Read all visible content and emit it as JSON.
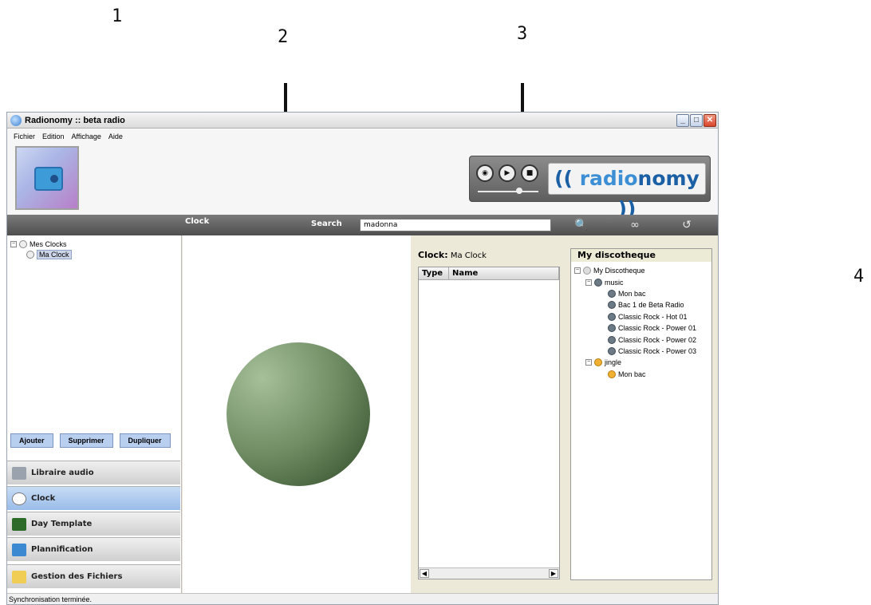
{
  "annotations": {
    "n1": "1",
    "n2": "2",
    "n3": "3",
    "n4": "4"
  },
  "window": {
    "title": "Radionomy :: beta radio"
  },
  "menu": [
    "Fichier",
    "Edition",
    "Affichage",
    "Aide"
  ],
  "brand": {
    "part1": "(( ",
    "part2": "radio",
    "part3": "nomy ))"
  },
  "toolbar": {
    "clock_label": "Clock",
    "search_label": "Search",
    "search_value": "madonna"
  },
  "clocks_tree": {
    "root": "Mes Clocks",
    "child": "Ma Clock"
  },
  "clock_buttons": {
    "add": "Ajouter",
    "delete": "Supprimer",
    "duplicate": "Dupliquer"
  },
  "nav": [
    {
      "label": "Libraire audio"
    },
    {
      "label": "Clock"
    },
    {
      "label": "Day Template"
    },
    {
      "label": "Plannification"
    },
    {
      "label": "Gestion des Fichiers"
    }
  ],
  "clock_panel": {
    "title_label": "Clock:",
    "title_value": "Ma Clock",
    "col_type": "Type",
    "col_name": "Name"
  },
  "discotheque": {
    "title": "My discotheque",
    "root": "My Discotheque",
    "music_folder": "music",
    "music_items": [
      "Mon bac",
      "Bac 1 de Beta Radio",
      "Classic Rock - Hot 01",
      "Classic Rock - Power 01",
      "Classic Rock - Power 02",
      "Classic Rock - Power 03"
    ],
    "jingle_folder": "jingle",
    "jingle_items": [
      "Mon bac"
    ]
  },
  "status": "Synchronisation terminée."
}
